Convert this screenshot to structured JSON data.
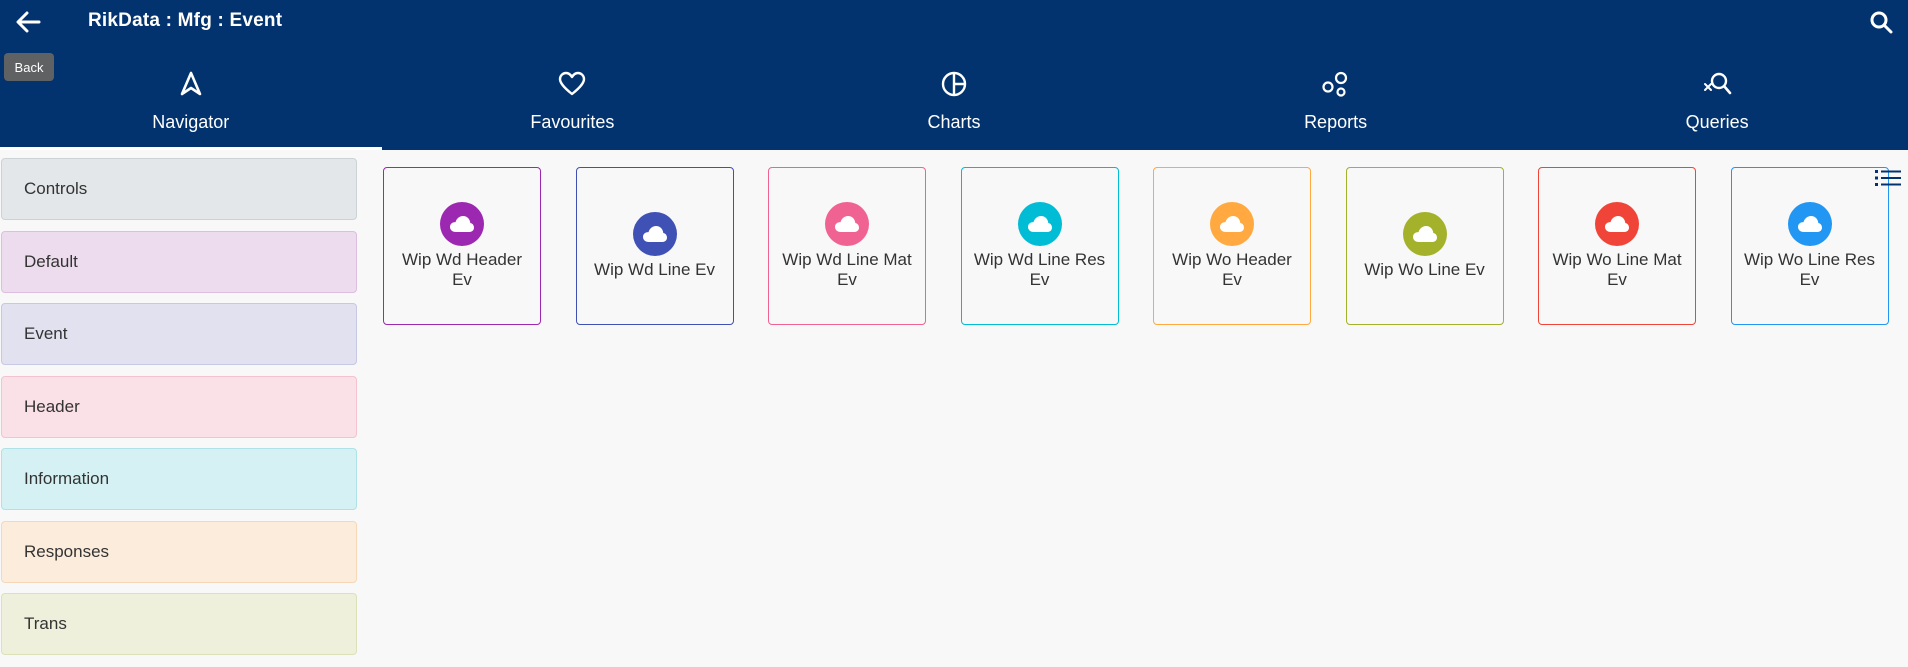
{
  "header": {
    "title": "RikData :  Mfg :  Event",
    "back_tooltip": "Back",
    "back_icon": "arrow-left-icon",
    "search_icon": "search-icon"
  },
  "tabs": [
    {
      "label": "Navigator",
      "icon": "navigator-icon",
      "active": true
    },
    {
      "label": "Favourites",
      "icon": "heart-icon",
      "active": false
    },
    {
      "label": "Charts",
      "icon": "pie-chart-icon",
      "active": false
    },
    {
      "label": "Reports",
      "icon": "reports-icon",
      "active": false
    },
    {
      "label": "Queries",
      "icon": "query-search-icon",
      "active": false
    }
  ],
  "sidebar": {
    "items": [
      {
        "label": "Controls",
        "bg": "#e3e7e9",
        "border": "#cbd3d6"
      },
      {
        "label": "Default",
        "bg": "#eddcee",
        "border": "#dcbfe0"
      },
      {
        "label": "Event",
        "bg": "#e1e1f0",
        "border": "#c6c8e4"
      },
      {
        "label": "Header",
        "bg": "#fae0e7",
        "border": "#f3c3d0"
      },
      {
        "label": "Information",
        "bg": "#d5f1f3",
        "border": "#aee2e6"
      },
      {
        "label": "Responses",
        "bg": "#fcecdc",
        "border": "#f6d8b8"
      },
      {
        "label": "Trans",
        "bg": "#eef0dc",
        "border": "#dde1b8"
      }
    ]
  },
  "tiles": [
    {
      "label": "Wip Wd Header Ev",
      "color": "#9c27b0",
      "icon": "cloud-icon"
    },
    {
      "label": "Wip Wd Line Ev",
      "color": "#3f51b5",
      "icon": "cloud-icon"
    },
    {
      "label": "Wip Wd Line Mat Ev",
      "color": "#f06292",
      "icon": "cloud-icon"
    },
    {
      "label": "Wip Wd Line Res Ev",
      "color": "#00bcd4",
      "icon": "cloud-icon"
    },
    {
      "label": "Wip Wo Header Ev",
      "color": "#ffa940",
      "icon": "cloud-icon"
    },
    {
      "label": "Wip Wo Line Ev",
      "color": "#a4b12b",
      "icon": "cloud-icon"
    },
    {
      "label": "Wip Wo Line Mat Ev",
      "color": "#f04438",
      "icon": "cloud-icon"
    },
    {
      "label": "Wip Wo Line Res Ev",
      "color": "#2196f3",
      "icon": "cloud-icon"
    }
  ],
  "list_icon": "list-icon"
}
